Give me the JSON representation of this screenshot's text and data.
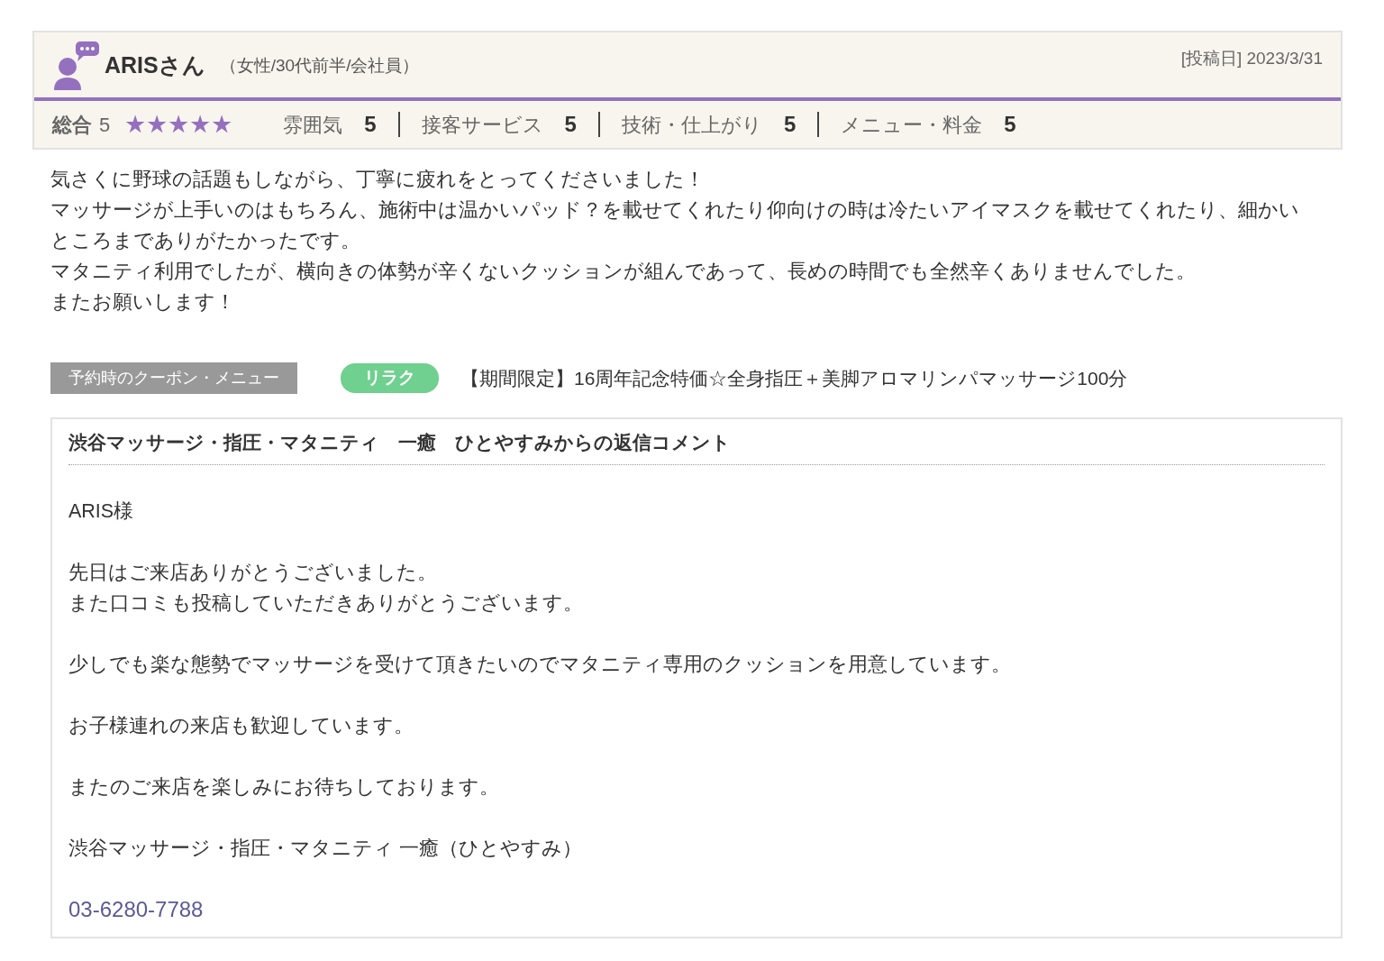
{
  "review": {
    "reviewer": "ARISさん",
    "profile": "（女性/30代前半/会社員）",
    "posted": "[投稿日] 2023/3/31",
    "overall": {
      "label": "総合",
      "score": "5",
      "stars": 5
    },
    "ratings": [
      {
        "label": "雰囲気",
        "score": "5"
      },
      {
        "label": "接客サービス",
        "score": "5"
      },
      {
        "label": "技術・仕上がり",
        "score": "5"
      },
      {
        "label": "メニュー・料金",
        "score": "5"
      }
    ],
    "body": [
      "気さくに野球の話題もしながら、丁寧に疲れをとってくださいました！",
      "マッサージが上手いのはもちろん、施術中は温かいパッド？を載せてくれたり仰向けの時は冷たいアイマスクを載せてくれたり、細かいところまでありがたかったです。",
      "マタニティ利用でしたが、横向きの体勢が辛くないクッションが組んであって、長めの時間でも全然辛くありませんでした。",
      "またお願いします！"
    ],
    "coupon": {
      "label": "予約時のクーポン・メニュー",
      "tag": "リラク",
      "name": "【期間限定】16周年記念特価☆全身指圧＋美脚アロマリンパマッサージ100分"
    }
  },
  "reply": {
    "title": "渋谷マッサージ・指圧・マタニティ　一癒　ひとやすみからの返信コメント",
    "paragraphs": [
      [
        "ARIS様"
      ],
      [
        "先日はご来店ありがとうございました。",
        "また口コミも投稿していただきありがとうございます。"
      ],
      [
        "少しでも楽な態勢でマッサージを受けて頂きたいのでマタニティ専用のクッションを用意しています。"
      ],
      [
        "お子様連れの来店も歓迎しています。"
      ],
      [
        "またのご来店を楽しみにお待ちしております。"
      ],
      [
        "渋谷マッサージ・指圧・マタニティ 一癒（ひとやすみ）"
      ]
    ],
    "phone": "03-6280-7788"
  }
}
